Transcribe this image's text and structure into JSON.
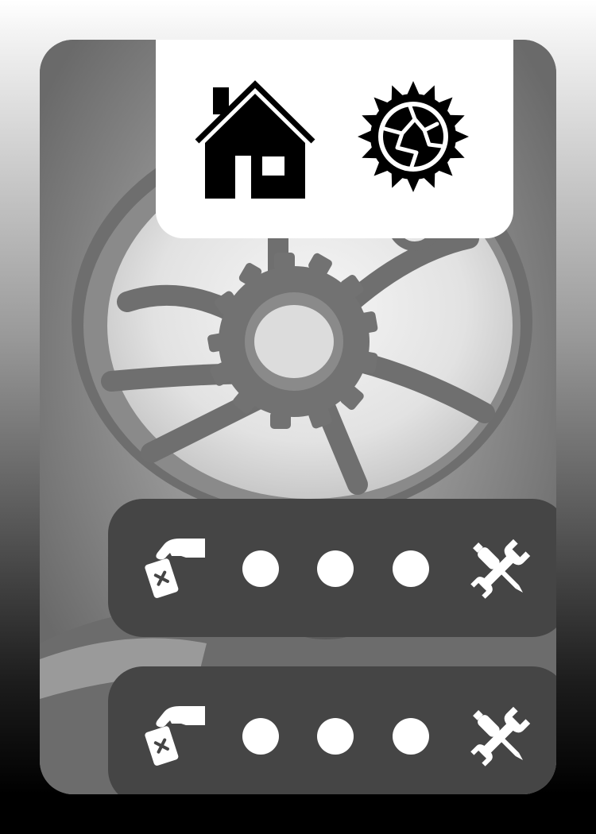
{
  "card": {
    "background_art": "gear-wheel-artwork",
    "palette": {
      "panel_dark": "#454545",
      "panel_light": "#ffffff",
      "icon_dark": "#000000",
      "icon_light": "#ffffff"
    }
  },
  "top_panel": {
    "icons": [
      "home-icon",
      "broken-sun-icon"
    ]
  },
  "rows": [
    {
      "icons": [
        "hand-card-icon",
        "tools-icon"
      ],
      "pips": 3
    },
    {
      "icons": [
        "hand-card-icon",
        "tools-icon"
      ],
      "pips": 3
    }
  ]
}
